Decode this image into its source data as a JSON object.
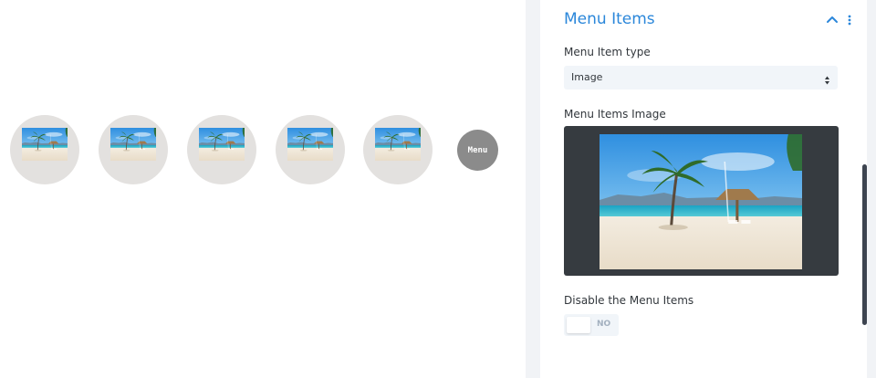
{
  "canvas": {
    "menu_items": [
      {
        "image": "beach-photo"
      },
      {
        "image": "beach-photo"
      },
      {
        "image": "beach-photo"
      },
      {
        "image": "beach-photo"
      },
      {
        "image": "beach-photo"
      }
    ],
    "menu_toggle_label": "Menu"
  },
  "panel": {
    "section_title": "Menu Items",
    "collapse_icon": "chevron-up-icon",
    "more_icon": "vertical-dots-icon",
    "menu_item_type": {
      "label": "Menu Item type",
      "value": "Image"
    },
    "menu_items_image": {
      "label": "Menu Items Image",
      "image": "beach-photo"
    },
    "disable_menu_items": {
      "label": "Disable the Menu Items",
      "state": "NO"
    }
  },
  "colors": {
    "accent": "#2b87da",
    "circle_bg": "#e3e1df",
    "menu_button_bg": "#8b8b8b",
    "image_box_bg": "#363b40"
  }
}
